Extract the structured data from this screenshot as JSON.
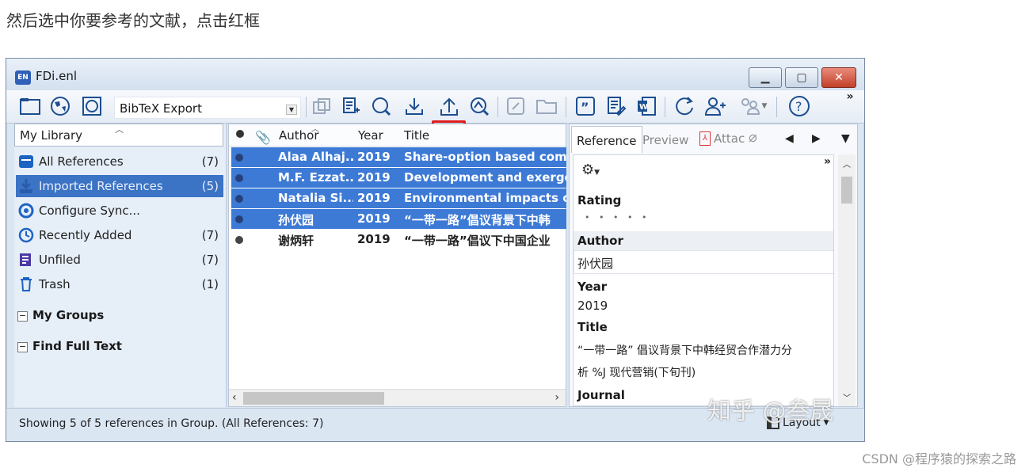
{
  "caption": "然后选中你要参考的文献，点击红框",
  "window": {
    "title": "FDi.enl",
    "app_icon": "EN",
    "buttons": [
      "minimize-icon",
      "maximize-icon",
      "close-icon"
    ]
  },
  "toolbar": {
    "style": "BibTeX Export",
    "more": "»",
    "highlight_color": "#e21c1c"
  },
  "library": {
    "header": "My Library",
    "groups": [
      {
        "label": "All References",
        "count": "(7)",
        "icon": "all-references-icon"
      },
      {
        "label": "Imported References",
        "count": "(5)",
        "icon": "import-icon",
        "selected": true
      },
      {
        "label": "Configure Sync...",
        "count": "",
        "icon": "sync-icon"
      },
      {
        "label": "Recently Added",
        "count": "(7)",
        "icon": "clock-icon"
      },
      {
        "label": "Unfiled",
        "count": "(7)",
        "icon": "unfiled-icon"
      },
      {
        "label": "Trash",
        "count": "(1)",
        "icon": "trash-icon"
      }
    ],
    "sections": [
      "My Groups",
      "Find Full Text"
    ]
  },
  "references": {
    "columns": [
      "Author",
      "Year",
      "Title"
    ],
    "rows": [
      {
        "author": "Alaa Alhaj...",
        "year": "2019",
        "title": "Share-option based compe",
        "selected": true
      },
      {
        "author": "M.F. Ezzat...",
        "year": "2019",
        "title": "Development and exergeti",
        "selected": true
      },
      {
        "author": "Natalia Si...",
        "year": "2019",
        "title": "Environmental impacts of h",
        "selected": true
      },
      {
        "author": "孙伏园",
        "year": "2019",
        "title": "“一带一路”倡议背景下中韩",
        "selected": true
      },
      {
        "author": "谢炳轩",
        "year": "2019",
        "title": "“一带一路”倡议下中国企业",
        "selected": false
      }
    ]
  },
  "detail": {
    "tabs": [
      "Reference",
      "Preview",
      "Attac"
    ],
    "fields": {
      "rating_label": "Rating",
      "rating_dots": "• • • • •",
      "author_label": "Author",
      "author_value": "孙伏园",
      "year_label": "Year",
      "year_value": "2019",
      "title_label": "Title",
      "title_line1": "“一带一路” 倡议背景下中韩经贸合作潜力分",
      "title_line2": "析 %J 现代营销(下旬刊)",
      "journal_label": "Journal"
    }
  },
  "status": {
    "text": "Showing 5 of 5 references in Group. (All References: 7)",
    "layout": "Layout"
  },
  "watermarks": {
    "zhihu": "知乎 @叁晟",
    "csdn": "CSDN @程序猿的探索之路"
  }
}
